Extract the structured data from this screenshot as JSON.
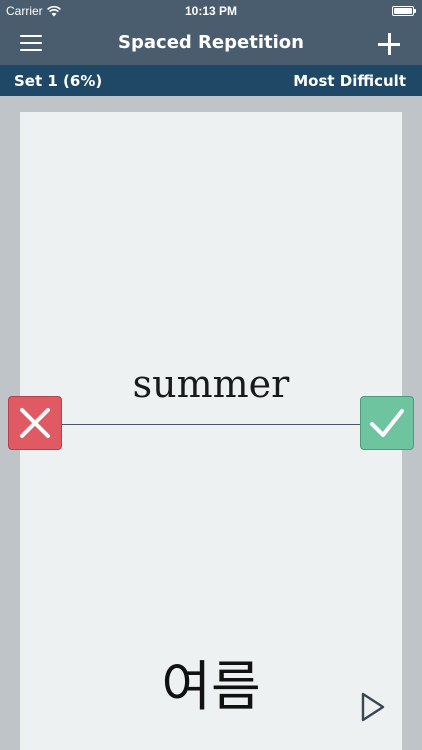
{
  "status_bar": {
    "carrier": "Carrier",
    "time": "10:13 PM",
    "icons": [
      "wifi-icon",
      "battery-icon"
    ]
  },
  "nav_bar": {
    "title": "Spaced Repetition",
    "left_icon": "menu-icon",
    "right_icon": "add-icon"
  },
  "set_bar": {
    "set_label": "Set 1 (6%)",
    "sort_label": "Most Difficult"
  },
  "card": {
    "term": "summer",
    "translation": "여름",
    "wrong_icon": "close-icon",
    "correct_icon": "checkmark-icon",
    "play_icon": "play-icon"
  },
  "colors": {
    "nav_background": "#4a5d6e",
    "set_bar_background": "#1f4766",
    "page_background": "#bfc4c9",
    "card_background": "#eef1f2",
    "wrong": "#e05a63",
    "correct": "#6fc4a0"
  }
}
